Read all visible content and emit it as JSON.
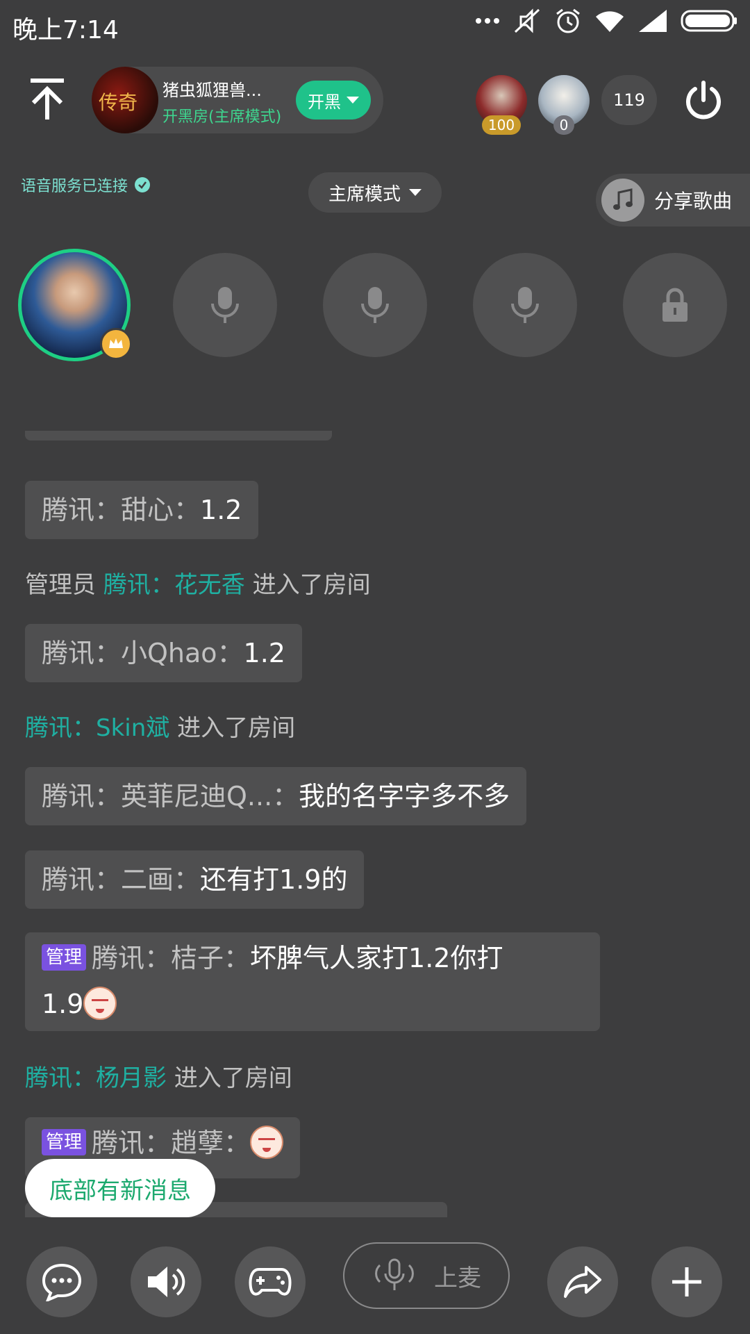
{
  "status_bar": {
    "time": "晚上7:14",
    "icons": [
      "more-dots-icon",
      "mute-icon",
      "alarm-icon",
      "wifi-icon",
      "signal-icon",
      "battery-icon"
    ]
  },
  "header": {
    "room_name": "猪虫狐狸兽...",
    "room_mode": "开黑房(主席模式)",
    "room_avatar_text": "传奇",
    "kaihei_label": "开黑",
    "top_users": [
      {
        "badge": "100"
      },
      {
        "badge": "0"
      }
    ],
    "online_count": "119"
  },
  "toolbar": {
    "voice_status": "语音服务已连接",
    "mode_select": "主席模式",
    "share_song": "分享歌曲"
  },
  "chat": {
    "msg1": {
      "sender": "腾讯：甜心：",
      "text": "1.2"
    },
    "sys1": {
      "prefix": "管理员 ",
      "user": "腾讯：花无香",
      "suffix": " 进入了房间"
    },
    "msg2": {
      "sender": "腾讯：小Qhao：",
      "text": "1.2"
    },
    "sys2": {
      "user": "腾讯：Skin斌",
      "suffix": " 进入了房间"
    },
    "msg3": {
      "sender": "腾讯：英菲尼迪Q...：",
      "text": "我的名字字多不多"
    },
    "msg4": {
      "sender": "腾讯：二画：",
      "text": "还有打1.9的"
    },
    "msg5": {
      "tag": "管理",
      "sender": "腾讯：桔子：",
      "text_line1": "坏脾气人家打1.2你打",
      "text_line2": "1.9"
    },
    "sys3": {
      "user": "腾讯：杨月影",
      "suffix": " 进入了房间"
    },
    "msg6": {
      "tag": "管理",
      "sender": "腾讯：趙孽："
    }
  },
  "new_message_label": "底部有新消息",
  "bottom_bar": {
    "mic_label": "上麦"
  },
  "colors": {
    "background": "#3d3d3e",
    "accent_green": "#1fc28a",
    "username_teal": "#1fb0a2",
    "admin_purple": "#7a52e0"
  }
}
